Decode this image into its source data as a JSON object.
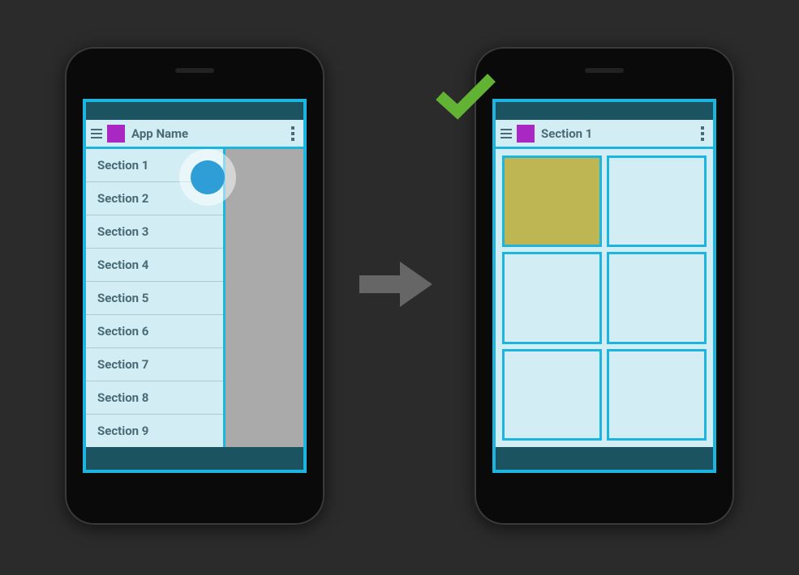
{
  "left_phone": {
    "app_title": "App Name",
    "drawer_items": [
      {
        "label": "Section 1"
      },
      {
        "label": "Section 2"
      },
      {
        "label": "Section 3"
      },
      {
        "label": "Section 4"
      },
      {
        "label": "Section 5"
      },
      {
        "label": "Section 6"
      },
      {
        "label": "Section 7"
      },
      {
        "label": "Section 8"
      },
      {
        "label": "Section 9"
      }
    ]
  },
  "right_phone": {
    "app_title": "Section 1",
    "grid_cells": 6,
    "highlighted_index": 0
  },
  "colors": {
    "accent": "#1bb5e0",
    "brand": "#a928c4",
    "background": "#d3edf4",
    "statusbar": "#1c5361",
    "highlight_tile": "#beb553",
    "checkmark": "#62b234",
    "arrow": "#666666"
  }
}
